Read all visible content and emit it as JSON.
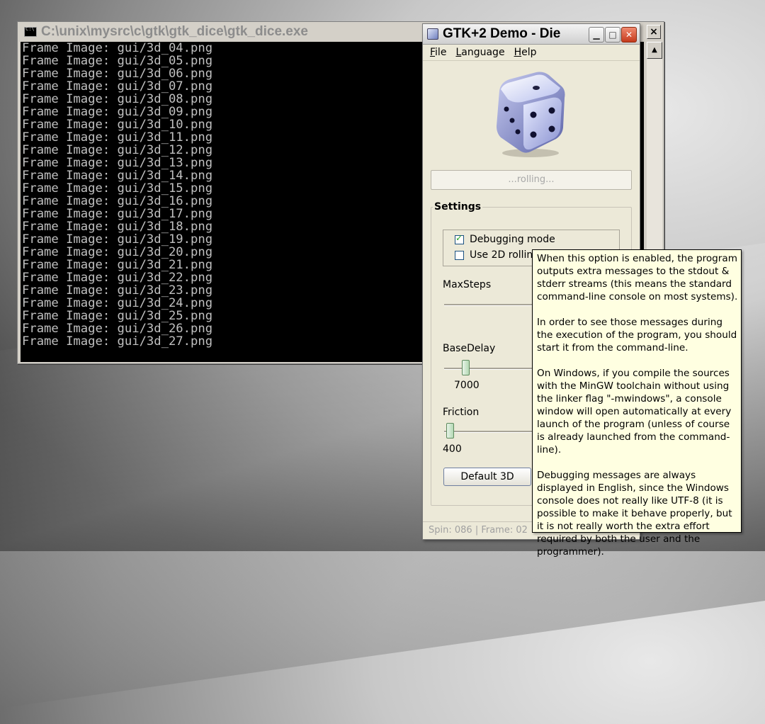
{
  "console": {
    "title": "C:\\unix\\mysrc\\c\\gtk\\gtk_dice\\gtk_dice.exe",
    "close_label": "×",
    "lines": [
      "Frame Image: gui/3d_04.png",
      "Frame Image: gui/3d_05.png",
      "Frame Image: gui/3d_06.png",
      "Frame Image: gui/3d_07.png",
      "Frame Image: gui/3d_08.png",
      "Frame Image: gui/3d_09.png",
      "Frame Image: gui/3d_10.png",
      "Frame Image: gui/3d_11.png",
      "Frame Image: gui/3d_12.png",
      "Frame Image: gui/3d_13.png",
      "Frame Image: gui/3d_14.png",
      "Frame Image: gui/3d_15.png",
      "Frame Image: gui/3d_16.png",
      "Frame Image: gui/3d_17.png",
      "Frame Image: gui/3d_18.png",
      "Frame Image: gui/3d_19.png",
      "Frame Image: gui/3d_20.png",
      "Frame Image: gui/3d_21.png",
      "Frame Image: gui/3d_22.png",
      "Frame Image: gui/3d_23.png",
      "Frame Image: gui/3d_24.png",
      "Frame Image: gui/3d_25.png",
      "Frame Image: gui/3d_26.png",
      "Frame Image: gui/3d_27.png"
    ]
  },
  "gtk": {
    "title": "GTK+2 Demo - Die",
    "menu": [
      "File",
      "Language",
      "Help"
    ],
    "progress_text": "...rolling...",
    "settings_label": "Settings",
    "debug_label": "Debugging mode",
    "debug_checked": true,
    "use2d_label": "Use 2D rolling-",
    "maxsteps_label": "MaxSteps",
    "basedelay_label": "BaseDelay",
    "basedelay_value": "7000",
    "friction_label": "Friction",
    "friction_value": "400",
    "default_button": "Default 3D",
    "status_text": "Spin: 086 | Frame: 02"
  },
  "tooltip": {
    "paragraphs": [
      "When this option is enabled, the program outputs extra messages to the stdout & stderr streams (this means the standard command-line console on most systems).",
      "In order to see those messages during the execution of the program, you should start it from the command-line.",
      "On Windows, if you compile the sources with the MinGW toolchain without using the linker flag \"-mwindows\", a console window will open automatically at every launch of the program (unless of course is already launched from the command-line).",
      "Debugging messages are always displayed in English, since the Windows console does not really like UTF-8 (it is possible to make it behave properly, but it is not really worth the extra effort required by both the user and the programmer)."
    ]
  },
  "icons": {
    "console_icon": "cmd-icon",
    "app_icon": "gtk-app-icon",
    "die_image": "die-3d-icon"
  }
}
